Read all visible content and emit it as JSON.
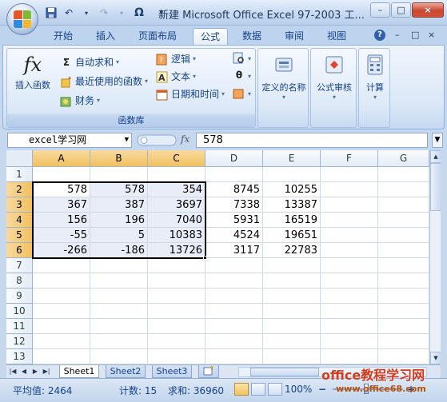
{
  "window": {
    "title": "新建 Microsoft Office Excel 97-2003 工...",
    "minimize": "–",
    "maximize": "□",
    "close": "×"
  },
  "qat": {
    "undo": "↶",
    "redo": "↷",
    "omega": "Ω",
    "more": "▾"
  },
  "tabs": [
    "开始",
    "插入",
    "页面布局",
    "公式",
    "数据",
    "审阅",
    "视图"
  ],
  "active_tab": "公式",
  "tab_right": {
    "help": "?",
    "min": "–",
    "restore": "□",
    "close": "×"
  },
  "ribbon": {
    "groups": {
      "function_library": {
        "label": "函数库",
        "insert_function": "插入函数",
        "fx": "fx",
        "autosum": "自动求和",
        "recent": "最近使用的函数",
        "financial": "财务",
        "logical": "逻辑",
        "text": "文本",
        "datetime": "日期和时间",
        "sigma": "Σ"
      },
      "defined_names": {
        "label": "定义的名称"
      },
      "formula_auditing": {
        "label": "公式审核"
      },
      "calculation": {
        "label": "计算"
      }
    }
  },
  "formula_bar": {
    "name_box": "excel学习网",
    "fx": "fx",
    "value": "578"
  },
  "grid": {
    "columns": [
      "A",
      "B",
      "C",
      "D",
      "E",
      "F",
      "G"
    ],
    "rows": [
      "1",
      "2",
      "3",
      "4",
      "5",
      "6",
      "7",
      "8",
      "9",
      "10",
      "11",
      "12",
      "13"
    ],
    "data": {
      "2": [
        "578",
        "578",
        "354",
        "8745",
        "10255",
        "",
        ""
      ],
      "3": [
        "367",
        "387",
        "3697",
        "7338",
        "13387",
        "",
        ""
      ],
      "4": [
        "156",
        "196",
        "7040",
        "5931",
        "16519",
        "",
        ""
      ],
      "5": [
        "-55",
        "5",
        "10383",
        "4524",
        "19651",
        "",
        ""
      ],
      "6": [
        "-266",
        "-186",
        "13726",
        "3117",
        "22783",
        "",
        ""
      ]
    }
  },
  "sheets": [
    "Sheet1",
    "Sheet2",
    "Sheet3"
  ],
  "active_sheet": "Sheet1",
  "status": {
    "average": "平均值: 2464",
    "count": "计数: 15",
    "sum": "求和: 36960",
    "zoom": "100%",
    "zoom_minus": "−",
    "zoom_plus": "+"
  },
  "watermark": {
    "line1": "office教程学习网",
    "line2": "www.office68.com"
  }
}
